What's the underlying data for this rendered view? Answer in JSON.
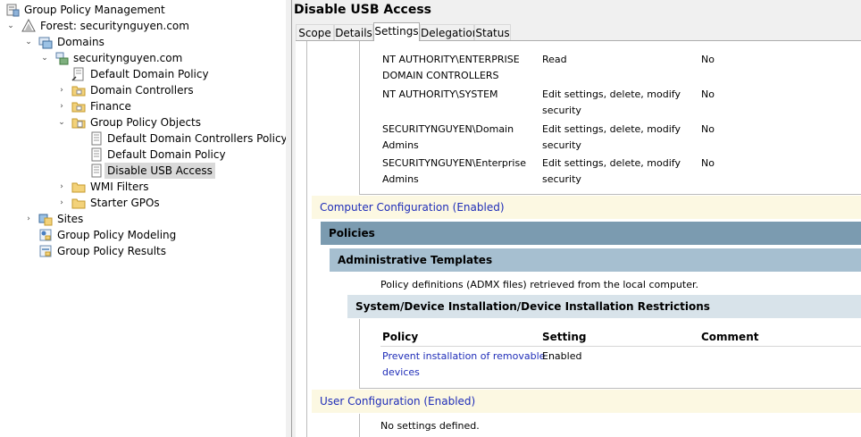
{
  "tree": {
    "root": "Group Policy Management",
    "forest": "Forest: securitynguyen.com",
    "domains": "Domains",
    "domain": "securitynguyen.com",
    "default_domain_policy": "Default Domain Policy",
    "domain_controllers": "Domain Controllers",
    "finance": "Finance",
    "gpo_folder": "Group Policy Objects",
    "gpos": [
      "Default Domain Controllers Policy",
      "Default Domain Policy",
      "Disable USB Access"
    ],
    "wmi_filters": "WMI Filters",
    "starter_gpos": "Starter GPOs",
    "sites": "Sites",
    "modeling": "Group Policy Modeling",
    "results": "Group Policy Results"
  },
  "right": {
    "title": "Disable USB Access",
    "tabs": [
      "Scope",
      "Details",
      "Settings",
      "Delegation",
      "Status"
    ],
    "active_tab": "Settings"
  },
  "delegation_rows": [
    {
      "name": [
        "NT AUTHORITY\\ENTERPRISE",
        "DOMAIN CONTROLLERS"
      ],
      "permission": [
        "Read"
      ],
      "inherited": "No"
    },
    {
      "name": [
        "NT AUTHORITY\\SYSTEM"
      ],
      "permission": [
        "Edit settings, delete, modify",
        "security"
      ],
      "inherited": "No"
    },
    {
      "name": [
        "SECURITYNGUYEN\\Domain",
        "Admins"
      ],
      "permission": [
        "Edit settings, delete, modify",
        "security"
      ],
      "inherited": "No"
    },
    {
      "name": [
        "SECURITYNGUYEN\\Enterprise",
        "Admins"
      ],
      "permission": [
        "Edit settings, delete, modify",
        "security"
      ],
      "inherited": "No"
    }
  ],
  "report": {
    "computer_config": "Computer Configuration (Enabled)",
    "policies": "Policies",
    "admin_templates": "Administrative Templates",
    "policy_definitions": "Policy definitions (ADMX files) retrieved from the local computer.",
    "category": "System/Device Installation/Device Installation Restrictions",
    "columns": [
      "Policy",
      "Setting",
      "Comment"
    ],
    "policy_rows": [
      {
        "policy": [
          "Prevent installation of removable",
          "devices"
        ],
        "setting": "Enabled",
        "comment": ""
      }
    ],
    "user_config": "User Configuration (Enabled)",
    "no_settings": "No settings defined."
  }
}
